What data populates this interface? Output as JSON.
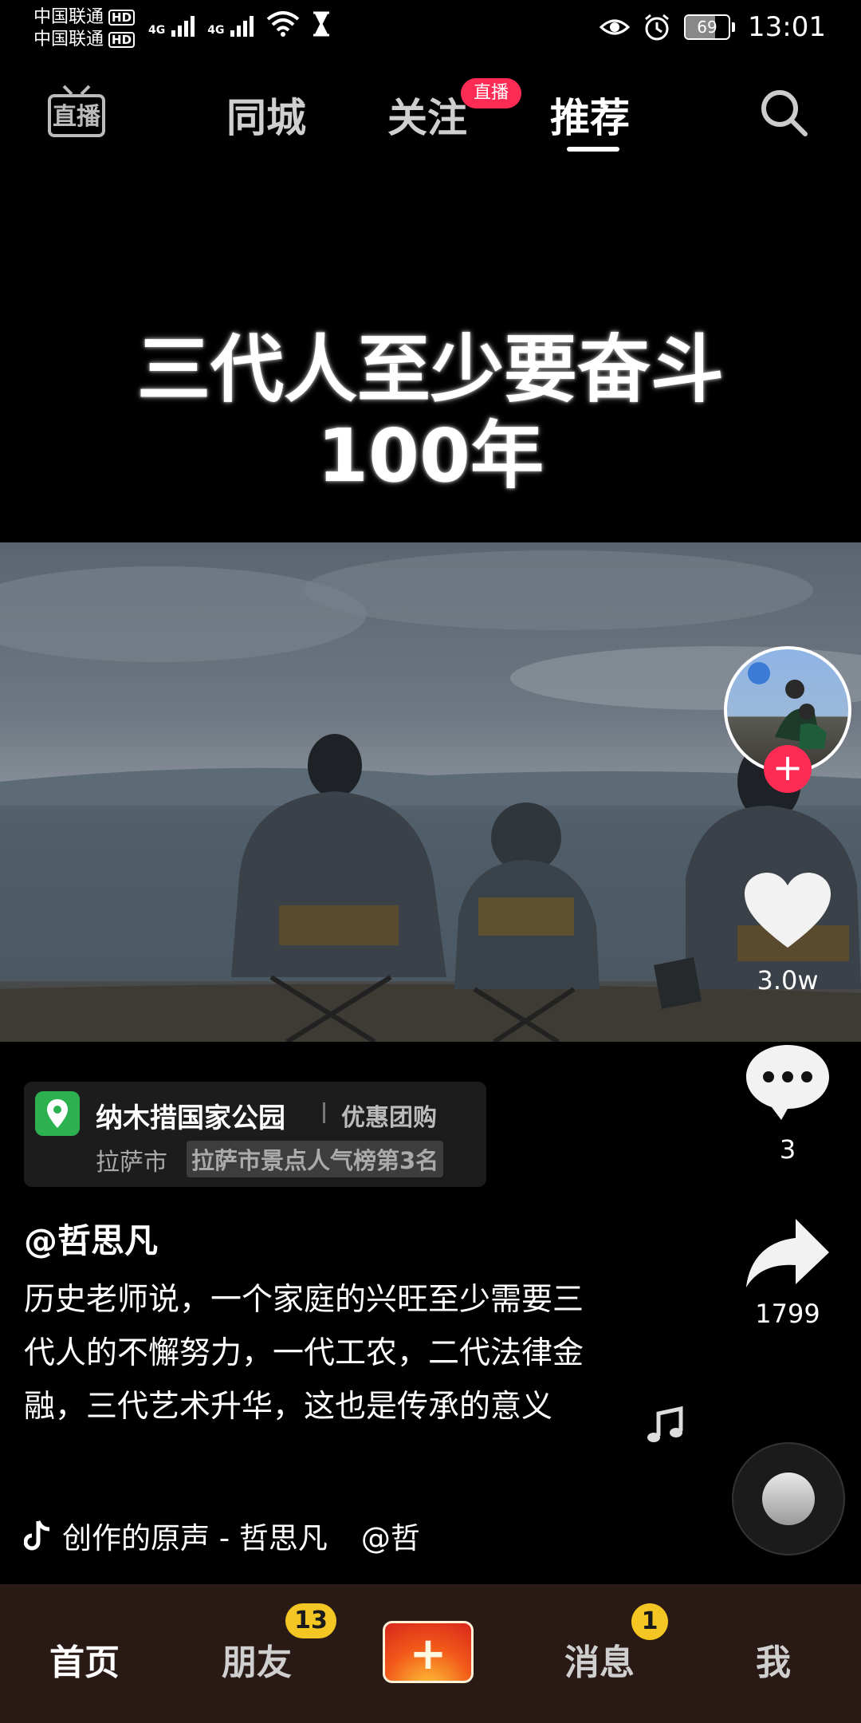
{
  "status_bar": {
    "carrier_1": "中国联通",
    "carrier_2": "中国联通",
    "hd_1": "HD",
    "hd_2": "HD",
    "net_1": "4G",
    "net_2": "4G",
    "battery_percent": "69",
    "time": "13:01"
  },
  "top_nav": {
    "live_icon_label": "直播",
    "tabs": [
      {
        "label": "同城"
      },
      {
        "label": "关注"
      },
      {
        "label": "推荐"
      }
    ],
    "live_badge": "直播"
  },
  "video": {
    "headline_line1": "三代人至少要奋斗",
    "headline_line2": "100年"
  },
  "side_actions": {
    "likes": "3.0w",
    "comments": "3",
    "shares": "1799"
  },
  "poi": {
    "name": "纳木措国家公园",
    "deal": "优惠团购",
    "city": "拉萨市",
    "rank": "拉萨市景点人气榜第3名"
  },
  "post": {
    "author": "@哲思凡",
    "description": "历史老师说，一个家庭的兴旺至少需要三代人的不懈努力，一代工农，二代法律金融，三代艺术升华，这也是传承的意义",
    "music": "创作的原声 - 哲思凡",
    "music_mention": "@哲"
  },
  "bottom_nav": {
    "home": "首页",
    "friends": "朋友",
    "friends_badge": "13",
    "messages": "消息",
    "messages_badge": "1",
    "me": "我"
  },
  "colors": {
    "accent": "#fe2c55",
    "badge": "#f3c623",
    "poi_pin": "#2db150",
    "bottom_bar": "#2a1a16"
  }
}
